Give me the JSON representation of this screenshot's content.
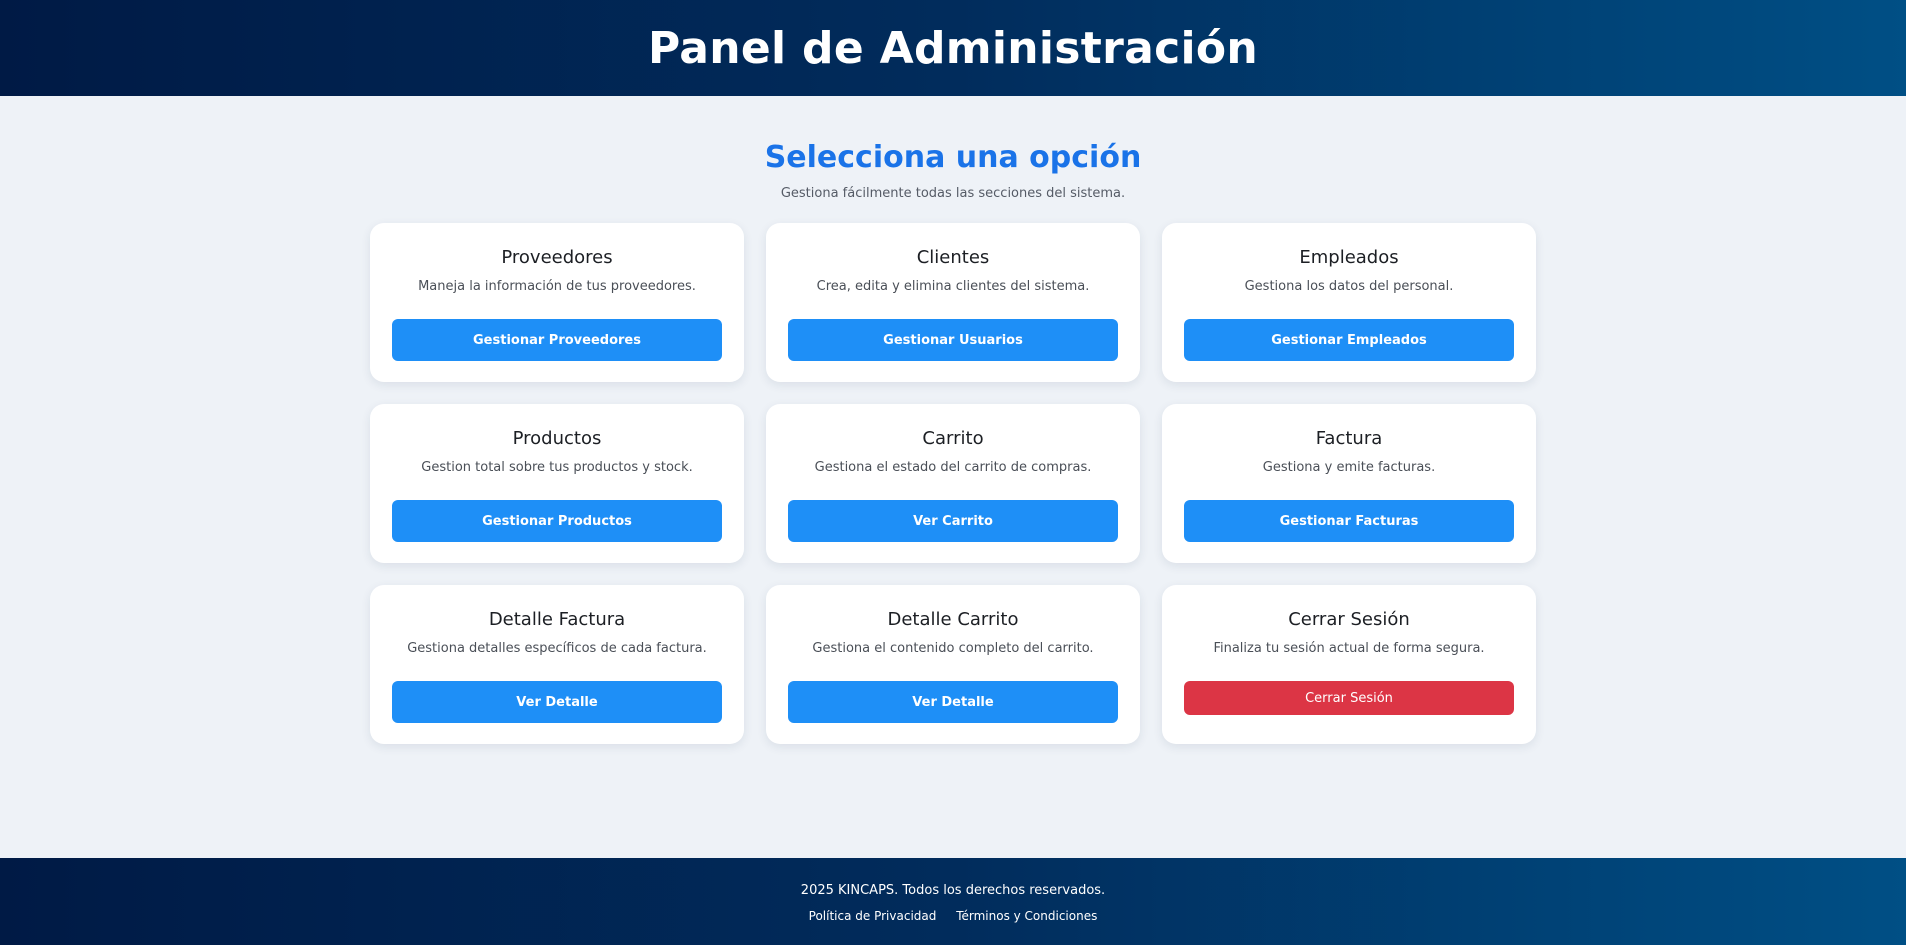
{
  "header": {
    "title": "Panel de Administración"
  },
  "intro": {
    "heading": "Selecciona una opción",
    "subtitle": "Gestiona fácilmente todas las secciones del sistema."
  },
  "cards": [
    {
      "title": "Proveedores",
      "description": "Maneja la información de tus proveedores.",
      "button": "Gestionar Proveedores"
    },
    {
      "title": "Clientes",
      "description": "Crea, edita y elimina clientes del sistema.",
      "button": "Gestionar Usuarios"
    },
    {
      "title": "Empleados",
      "description": "Gestiona los datos del personal.",
      "button": "Gestionar Empleados"
    },
    {
      "title": "Productos",
      "description": "Gestion total sobre tus productos y stock.",
      "button": "Gestionar Productos"
    },
    {
      "title": "Carrito",
      "description": "Gestiona el estado del carrito de compras.",
      "button": "Ver Carrito"
    },
    {
      "title": "Factura",
      "description": "Gestiona y emite facturas.",
      "button": "Gestionar Facturas"
    },
    {
      "title": "Detalle Factura",
      "description": "Gestiona detalles específicos de cada factura.",
      "button": "Ver Detalle"
    },
    {
      "title": "Detalle Carrito",
      "description": "Gestiona el contenido completo del carrito.",
      "button": "Ver Detalle"
    },
    {
      "title": "Cerrar Sesión",
      "description": "Finaliza tu sesión actual de forma segura.",
      "button": "Cerrar Sesión"
    }
  ],
  "footer": {
    "copyright": "2025 KINCAPS. Todos los derechos reservados.",
    "links": [
      "Política de Privacidad",
      "Términos y Condiciones"
    ]
  },
  "colors": {
    "header_gradient_start": "#001a45",
    "header_gradient_end": "#004f85",
    "accent_heading": "#1a73e8",
    "primary_button": "#1e8ff7",
    "danger_button": "#dc3545",
    "page_background": "#eef2f7",
    "card_background": "#ffffff"
  }
}
